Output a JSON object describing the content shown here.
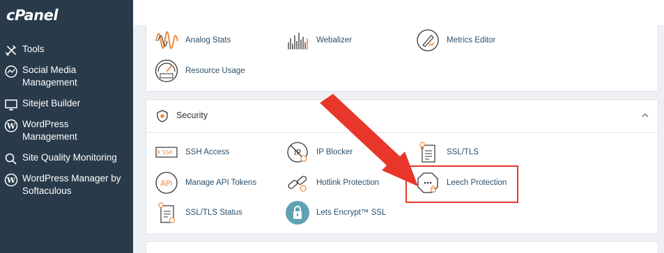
{
  "sidebar": {
    "logo": "cPanel",
    "items": [
      {
        "label": "Tools",
        "icon": "tools-icon"
      },
      {
        "label": "Social Media Management",
        "icon": "social-media-icon"
      },
      {
        "label": "Sitejet Builder",
        "icon": "sitejet-icon"
      },
      {
        "label": "WordPress Management",
        "icon": "wordpress-icon"
      },
      {
        "label": "Site Quality Monitoring",
        "icon": "search-icon"
      },
      {
        "label": "WordPress Manager by Softaculous",
        "icon": "wordpress-icon"
      }
    ]
  },
  "metrics": {
    "apps": [
      {
        "label": "Analog Stats",
        "icon": "analog-stats-icon"
      },
      {
        "label": "Webalizer",
        "icon": "webalizer-icon"
      },
      {
        "label": "Metrics Editor",
        "icon": "metrics-editor-icon"
      },
      {
        "label": "Resource Usage",
        "icon": "resource-usage-icon"
      }
    ]
  },
  "security": {
    "title": "Security",
    "apps": [
      {
        "label": "SSH Access",
        "icon": "ssh-icon"
      },
      {
        "label": "IP Blocker",
        "icon": "ip-blocker-icon"
      },
      {
        "label": "SSL/TLS",
        "icon": "ssl-tls-icon"
      },
      {
        "label": "Manage API Tokens",
        "icon": "api-icon"
      },
      {
        "label": "Hotlink Protection",
        "icon": "hotlink-icon"
      },
      {
        "label": "Leech Protection",
        "icon": "leech-protection-icon"
      },
      {
        "label": "SSL/TLS Status",
        "icon": "ssl-status-icon"
      },
      {
        "label": "Lets Encrypt™ SSL",
        "icon": "lets-encrypt-icon"
      }
    ]
  },
  "colors": {
    "sidebar_bg": "#293a4a",
    "link": "#27506f",
    "accent_orange": "#f0883a",
    "annotation_red": "#e8362a"
  }
}
